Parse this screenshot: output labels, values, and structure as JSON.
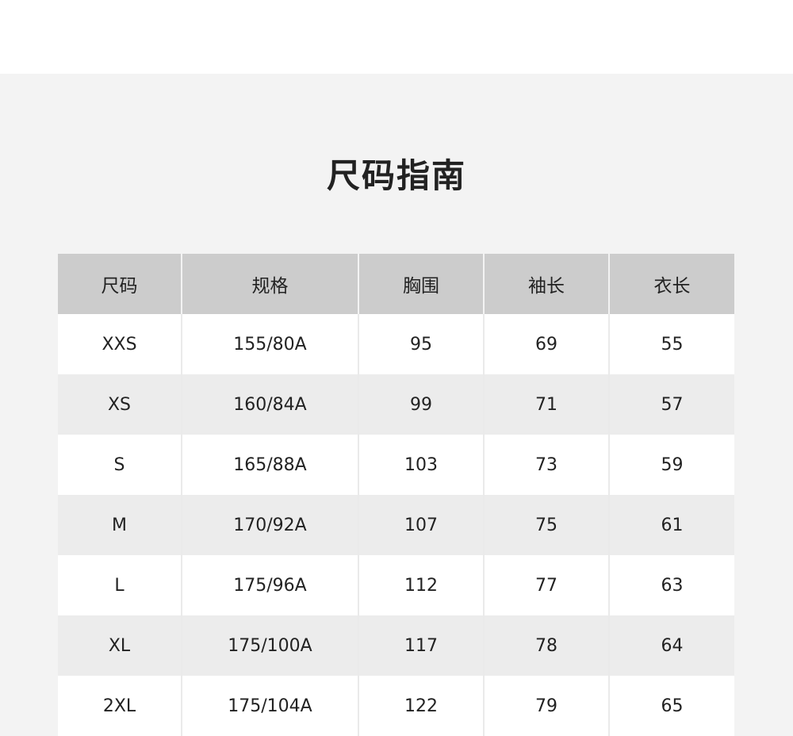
{
  "title": "尺码指南",
  "table": {
    "headers": [
      "尺码",
      "规格",
      "胸围",
      "袖长",
      "衣长"
    ],
    "rows": [
      [
        "XXS",
        "155/80A",
        "95",
        "69",
        "55"
      ],
      [
        "XS",
        "160/84A",
        "99",
        "71",
        "57"
      ],
      [
        "S",
        "165/88A",
        "103",
        "73",
        "59"
      ],
      [
        "M",
        "170/92A",
        "107",
        "75",
        "61"
      ],
      [
        "L",
        "175/96A",
        "112",
        "77",
        "63"
      ],
      [
        "XL",
        "175/100A",
        "117",
        "78",
        "64"
      ],
      [
        "2XL",
        "175/104A",
        "122",
        "79",
        "65"
      ]
    ]
  },
  "colors": {
    "header_bg": "#cccccc",
    "panel_bg": "#f3f3f3",
    "row_alt_bg": "#ececec",
    "text": "#222222"
  }
}
